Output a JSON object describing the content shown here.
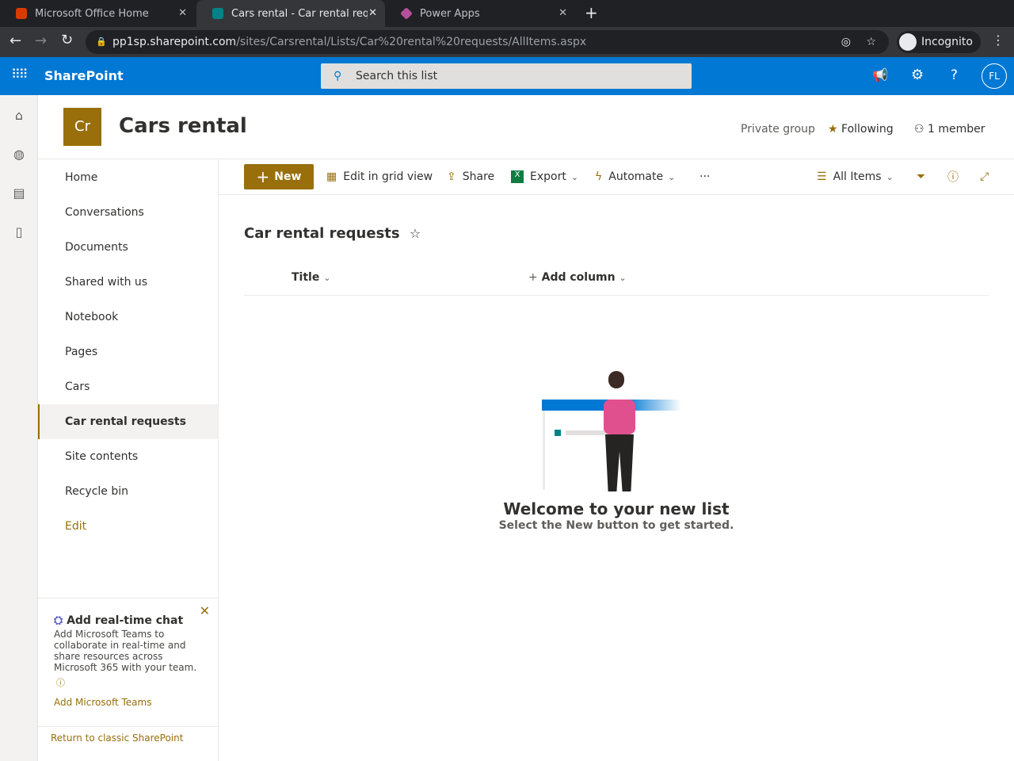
{
  "browser": {
    "tabs": [
      {
        "label": "Microsoft Office Home"
      },
      {
        "label": "Cars rental - Car rental req"
      },
      {
        "label": "Power Apps"
      }
    ],
    "url_host": "pp1sp.sharepoint.com",
    "url_path": "/sites/Carsrental/Lists/Car%20rental%20requests/AllItems.aspx",
    "incognito": "Incognito"
  },
  "suite": {
    "app": "SharePoint",
    "search_placeholder": "Search this list",
    "avatar": "FL"
  },
  "site": {
    "logo": "Cr",
    "title": "Cars rental",
    "privacy": "Private group",
    "following": "Following",
    "members": "1 member"
  },
  "nav": {
    "items": [
      "Home",
      "Conversations",
      "Documents",
      "Shared with us",
      "Notebook",
      "Pages",
      "Cars",
      "Car rental requests",
      "Site contents",
      "Recycle bin"
    ],
    "edit": "Edit"
  },
  "commands": {
    "new": "New",
    "grid": "Edit in grid view",
    "share": "Share",
    "export": "Export",
    "automate": "Automate",
    "more": "···",
    "view": "All Items"
  },
  "list": {
    "title": "Car rental requests",
    "col_title": "Title",
    "add_column": "Add column",
    "empty_title": "Welcome to your new list",
    "empty_sub": "Select the New button to get started."
  },
  "chat": {
    "title": "Add real-time chat",
    "body": "Add Microsoft Teams to collaborate in real-time and share resources across Microsoft 365 with your team.",
    "link": "Add Microsoft Teams"
  },
  "classic": "Return to classic SharePoint"
}
